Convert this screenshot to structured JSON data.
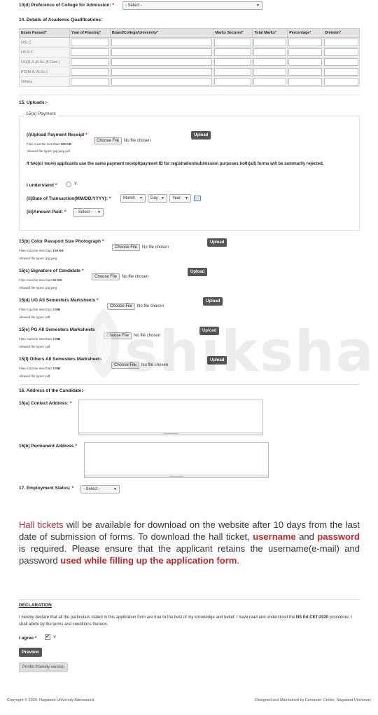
{
  "q13d": {
    "label": "13(d) Preference of College for Admission:",
    "value": "- Select -"
  },
  "q14": {
    "title": "14. Details of Academic Qualifications:",
    "headers": [
      "Exam Passed",
      "Year of Passing",
      "Board/College/University",
      "Marks Secured",
      "Total Marks",
      "Percentage",
      "Division"
    ],
    "header_required": [
      true,
      true,
      true,
      true,
      true,
      true,
      true
    ],
    "rows": [
      "HSLC",
      "HSSLC",
      "UG(B.A.,B.Sc.,B.Com.)",
      "PG(M.A.,M.Sc.)",
      "Others"
    ]
  },
  "q15": {
    "title": "15. Uploads:-",
    "payment_legend": "15(a) Payment",
    "receipt": {
      "label": "(i)Upload Payment Receipt",
      "choose": "Choose File",
      "nofile": "No file chosen",
      "upload": "Upload",
      "note1": "Files must be less than",
      "note1_size": "100 KB",
      "note2": "Allowed file types:",
      "note2_types": "jpg jpeg pdf"
    },
    "warning": "If two(or more) applicants use the same payment receipt/payment ID for registration/submission purposes both(all) forms will be summarily rejected.",
    "understand": {
      "label": "I understand",
      "option": "Y"
    },
    "date": {
      "label": "(ii)Date of Transaction(MM/DD/YYYY):",
      "month": "Month",
      "day": "Day",
      "year": "Year"
    },
    "amount": {
      "label": "(iii)Amount Paid:",
      "value": "- Select -"
    },
    "uploads": [
      {
        "label": "15(b) Color Passport Size Photograph",
        "required": true,
        "choose": "Choose File",
        "nofile": "No file chosen",
        "upload": "Upload",
        "size": "100 KB",
        "types": "jpg jpeg"
      },
      {
        "label": "15(c) Signature of Candidate",
        "required": true,
        "choose": "Choose File",
        "nofile": "No file chosen",
        "upload": "Upload",
        "size": "50 KB",
        "types": "jpg jpeg"
      },
      {
        "label": "15(d) UG All Semesters Marksheets",
        "required": true,
        "choose": "Choose File",
        "nofile": "No file chosen",
        "upload": "Upload",
        "size": "3 MB",
        "types": "pdf"
      },
      {
        "label": "15(e) PG All Semesters Marksheets",
        "required": false,
        "choose": "Choose File",
        "nofile": "No file chosen",
        "upload": "Upload",
        "size": "3 MB",
        "types": "pdf"
      },
      {
        "label": "15(f) Others All Semesters Marksheets",
        "required": false,
        "choose": "Choose File",
        "nofile": "No file chosen",
        "upload": "Upload",
        "size": "3 MB",
        "types": "pdf"
      }
    ],
    "note_size_prefix": "Files must be less than",
    "note_types_prefix": "Allowed file types:"
  },
  "q16": {
    "title": "16. Address of the Candidate:-",
    "contact": "16(a) Contact Address:",
    "permanent": "16(b) Permanent Address"
  },
  "q17": {
    "label": "17. Employment Status:",
    "value": "- Select -"
  },
  "info": {
    "t1": "Hall tickets",
    "t2": " will be available for download on the website after 10 days from the last date of submission of forms. To download the hall ticket, ",
    "t3": "username",
    "t4": " and ",
    "t5": "password",
    "t6": " is required. Please ensure that the applicant retains the username(e-mail) and password ",
    "t7": "used while filling up the application form",
    "t8": "."
  },
  "declaration": {
    "title": "DECLARATION",
    "text1": "I hereby declare that all the particulars stated in this application form are true to the best of my knowledge and belief. I have read and understood the ",
    "text_bold": "NS Ed.CET-2020",
    "text2": " procedure. I shall abide by the terms and conditions thereon.",
    "agree": "I agree",
    "agree_option": "Y",
    "preview": "Preview",
    "printer": "Printer-friendly version"
  },
  "watermark": "shiksha",
  "footer": {
    "left": "Copyright © 2020, Nagaland University Admissions.",
    "right": "Designed and Maintained by Computer Center, Nagaland University"
  },
  "required_mark": "*"
}
